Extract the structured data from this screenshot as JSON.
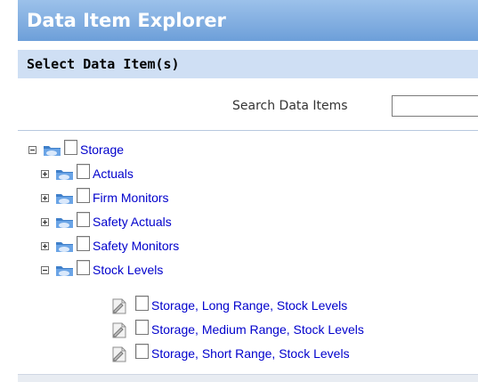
{
  "panel": {
    "title": "Data Item Explorer",
    "subtitle": "Select Data Item(s)"
  },
  "search": {
    "label": "Search Data Items",
    "value": ""
  },
  "tree": {
    "root": {
      "label": "Storage",
      "expanded": true,
      "checked": false
    },
    "children": [
      {
        "label": "Actuals",
        "expanded": false,
        "checked": false
      },
      {
        "label": "Firm Monitors",
        "expanded": false,
        "checked": false
      },
      {
        "label": "Safety Actuals",
        "expanded": false,
        "checked": false
      },
      {
        "label": "Safety Monitors",
        "expanded": false,
        "checked": false
      },
      {
        "label": "Stock Levels",
        "expanded": true,
        "checked": false
      }
    ],
    "leaves": [
      {
        "label": "Storage, Long Range, Stock Levels",
        "checked": false
      },
      {
        "label": "Storage, Medium Range, Stock Levels",
        "checked": false
      },
      {
        "label": "Storage, Short Range, Stock Levels",
        "checked": false
      }
    ]
  },
  "colors": {
    "title_bar": "#6d9fd9",
    "subtitle_bar": "#cfdff4",
    "link": "#0000cc"
  }
}
